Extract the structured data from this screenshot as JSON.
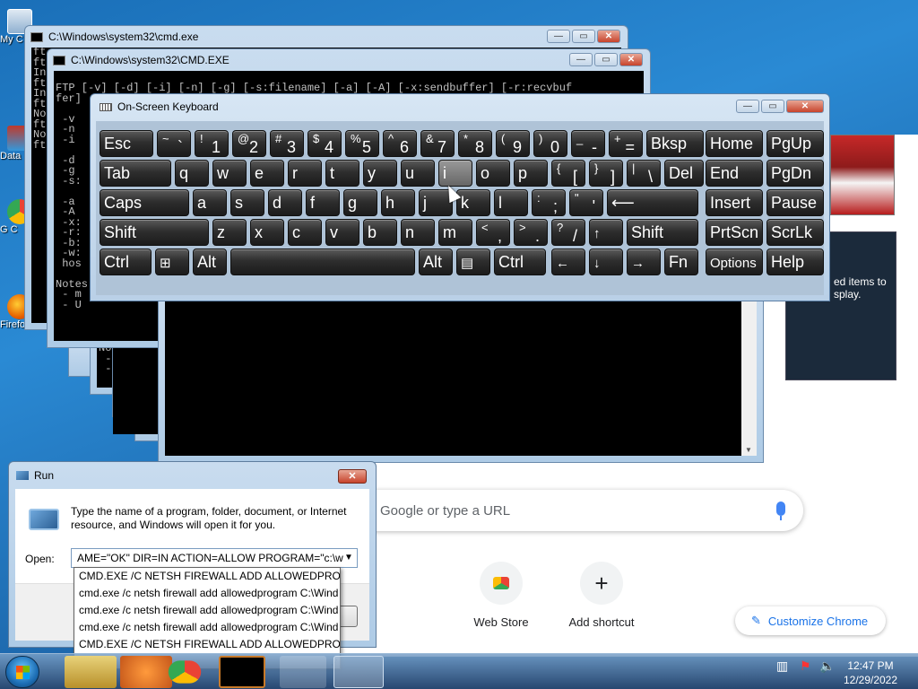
{
  "desktop_icons": [
    {
      "label": "My C",
      "icon": "computer-icon"
    },
    {
      "label": "Data",
      "icon": "data-icon"
    },
    {
      "label": "G C",
      "icon": "chrome-icon"
    },
    {
      "label": "Firefo",
      "icon": "firefox-icon"
    }
  ],
  "cmd1": {
    "title": "C:\\Windows\\system32\\cmd.exe",
    "lines": [
      "ft",
      "ft",
      "In",
      "ft",
      "In",
      "ft",
      "No",
      "ft",
      "No",
      "ft"
    ]
  },
  "cmd2": {
    "title": "C:\\Windows\\system32\\CMD.EXE",
    "lines": [
      "FTP [-v] [-d] [-i] [-n] [-g] [-s:filename] [-a] [-A] [-x:sendbuffer] [-r:recvbuf",
      "fer]",
      "",
      " -v",
      " -n",
      " -i",
      "",
      " -d",
      " -g",
      " -s:",
      "",
      " -a",
      " -A",
      " -x:",
      " -r:",
      " -b:",
      " -w:",
      " hos",
      "",
      "Notes",
      " - m",
      " - U"
    ]
  },
  "cmd3": {
    "lines": [
      "Notes",
      " - m",
      " - U"
    ]
  },
  "cmd4": {
    "lines": [
      "No"
    ]
  },
  "cmd5": {
    "lines": [
      " -w:",
      " hos"
    ]
  },
  "osk": {
    "title": "On-Screen Keyboard",
    "keys": {
      "esc": "Esc",
      "bksp": "Bksp",
      "home": "Home",
      "pgup": "PgUp",
      "tab": "Tab",
      "del": "Del",
      "end": "End",
      "pgdn": "PgDn",
      "caps": "Caps",
      "insert": "Insert",
      "pause": "Pause",
      "shift_left": "Shift",
      "shift_right": "Shift",
      "prtscn": "PrtScn",
      "scrlk": "ScrLk",
      "ctrl_left": "Ctrl",
      "alt_left": "Alt",
      "alt_right": "Alt",
      "ctrl_right": "Ctrl",
      "fn": "Fn",
      "options": "Options",
      "help": "Help",
      "q": "q",
      "w": "w",
      "e": "e",
      "r": "r",
      "t": "t",
      "y": "y",
      "u": "u",
      "i": "i",
      "o": "o",
      "p": "p",
      "a": "a",
      "s": "s",
      "d": "d",
      "f": "f",
      "g": "g",
      "h": "h",
      "j": "j",
      "k": "k",
      "l": "l",
      "z": "z",
      "x": "x",
      "c": "c",
      "v": "v",
      "b": "b",
      "n": "n",
      "m": "m"
    },
    "number_keys": [
      {
        "up": "~",
        "dn": "`"
      },
      {
        "up": "!",
        "dn": "1"
      },
      {
        "up": "@",
        "dn": "2"
      },
      {
        "up": "#",
        "dn": "3"
      },
      {
        "up": "$",
        "dn": "4"
      },
      {
        "up": "%",
        "dn": "5"
      },
      {
        "up": "^",
        "dn": "6"
      },
      {
        "up": "&",
        "dn": "7"
      },
      {
        "up": "*",
        "dn": "8"
      },
      {
        "up": "(",
        "dn": "9"
      },
      {
        "up": ")",
        "dn": "0"
      },
      {
        "up": "_",
        "dn": "-"
      },
      {
        "up": "+",
        "dn": "="
      }
    ],
    "bracket_keys": [
      {
        "up": "{",
        "dn": "["
      },
      {
        "up": "}",
        "dn": "]"
      },
      {
        "up": "|",
        "dn": "\\"
      }
    ],
    "semi_keys": [
      {
        "up": ":",
        "dn": ";"
      },
      {
        "up": "\"",
        "dn": "'"
      }
    ],
    "comma_keys": [
      {
        "up": "<",
        "dn": ","
      },
      {
        "up": ">",
        "dn": "."
      },
      {
        "up": "?",
        "dn": "/"
      }
    ],
    "arrows": {
      "up": "↑",
      "left": "←",
      "down": "↓",
      "right": "→",
      "enter": "⟵"
    }
  },
  "chrome": {
    "search_placeholder": "ch Google or type a URL",
    "shortcuts": [
      {
        "label": "Web Store"
      },
      {
        "label": "Add shortcut",
        "glyph": "+"
      }
    ],
    "customize_label": "Customize Chrome"
  },
  "notification": {
    "text": "ed items to splay."
  },
  "run": {
    "title": "Run",
    "description": "Type the name of a program, folder, document, or Internet resource, and Windows will open it for you.",
    "open_label": "Open:",
    "open_value": "AME=\"OK\" DIR=IN ACTION=ALLOW PROGRAM=\"c:\\w",
    "history": [
      "CMD.EXE /C NETSH FIREWALL ADD ALLOWEDPROGRA",
      "cmd.exe /c netsh firewall add allowedprogram C:\\Wind",
      "cmd.exe /c netsh firewall add allowedprogram C:\\Wind",
      "cmd.exe /c netsh firewall add allowedprogram C:\\Wind",
      "CMD.EXE /C NETSH FIREWALL ADD ALLOWEDPROGRA"
    ]
  },
  "taskbar": {
    "time": "12:47 PM",
    "date": "12/29/2022"
  },
  "colors": {
    "desktop_bg": "#1c64a8",
    "chrome_blue": "#1a73e8",
    "close_red": "#c7432c"
  }
}
